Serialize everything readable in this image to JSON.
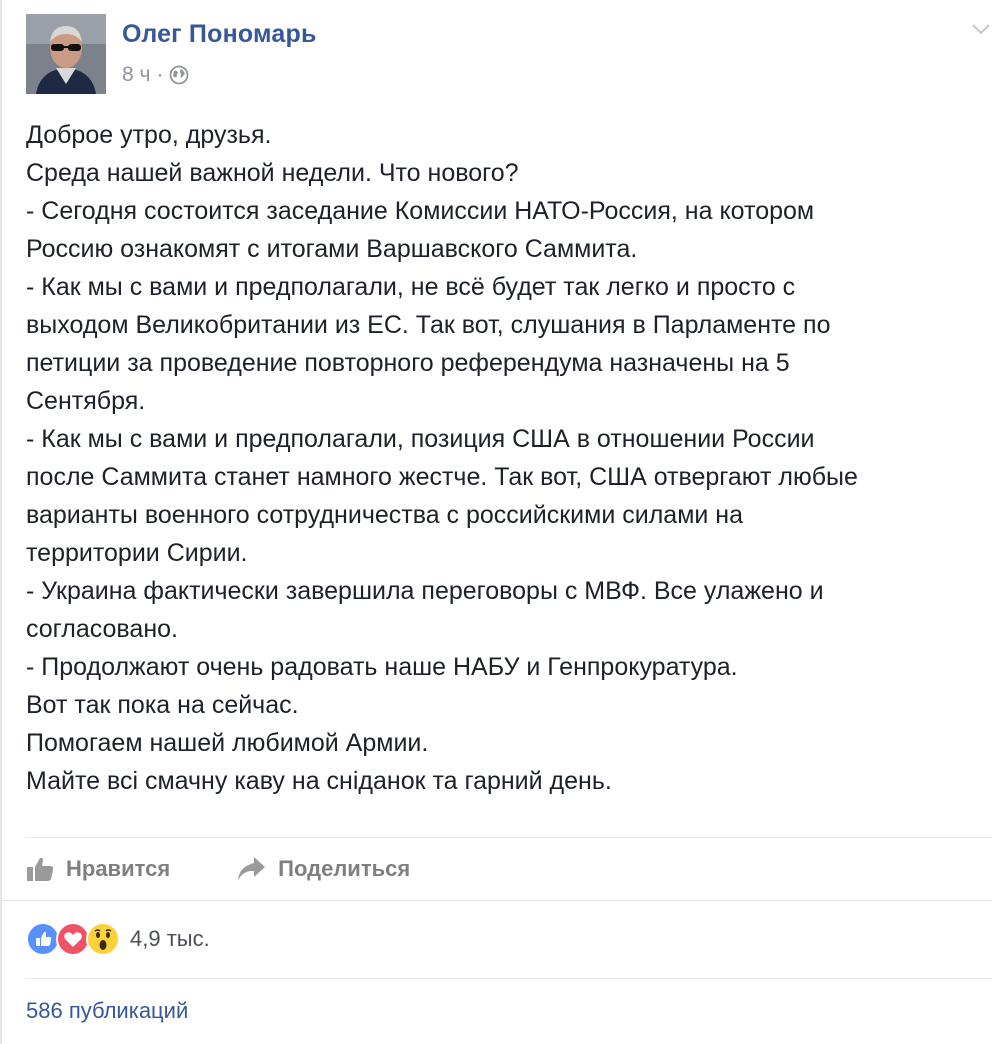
{
  "post": {
    "author": "Олег Пономарь",
    "time": "8 ч",
    "separator": "·",
    "privacy_icon": "globe-icon",
    "menu_icon": "chevron-down-icon",
    "lines": [
      "Доброе утро, друзья.",
      "Среда нашей важной недели. Что нового?",
      "- Сегодня состоится заседание Комиссии НАТО-Россия, на котором",
      "Россию ознакомят с итогами Варшавского Саммита.",
      "- Как мы с вами и предполагали, не всё будет так легко и просто с",
      "выходом Великобритании из ЕС. Так вот, слушания в Парламенте по",
      "петиции за проведение повторного референдума назначены на 5",
      "Сентября.",
      "- Как мы с вами и предполагали, позиция США в отношении России",
      "после Саммита станет намного жестче. Так вот, США отвергают любые",
      "варианты военного сотрудничества с российскими силами на",
      "территории Сирии.",
      "- Украина фактически завершила переговоры с МВФ. Все улажено и",
      "согласовано.",
      "- Продолжают очень радовать наше НАБУ и Генпрокуратура.",
      "Вот так пока на сейчас.",
      "Помогаем нашей любимой Армии.",
      "Майте всі смачну каву на сніданок та гарний день."
    ]
  },
  "actions": {
    "like_label": "Нравится",
    "like_icon": "thumbs-up-icon",
    "share_label": "Поделиться",
    "share_icon": "share-arrow-icon"
  },
  "reactions": {
    "icons": [
      "like-reaction-icon",
      "love-reaction-icon",
      "wow-reaction-icon"
    ],
    "count": "4,9 тыс."
  },
  "shares": {
    "label": "586 публикаций"
  },
  "colors": {
    "link": "#365899",
    "meta": "#90949c",
    "text": "#1d2129",
    "action": "#7f7f7f",
    "like": "#5890ff",
    "love": "#f25268",
    "wow": "#fcd23b"
  }
}
